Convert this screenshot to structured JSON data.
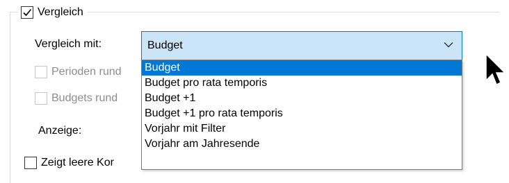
{
  "group": {
    "checkbox_label": "Vergleich",
    "checked": true
  },
  "compare": {
    "label": "Vergleich mit:",
    "selected": "Budget",
    "options": [
      "Budget",
      "Budget pro rata temporis",
      "Budget +1",
      "Budget +1 pro rata temporis",
      "Vorjahr mit Filter",
      "Vorjahr am Jahresende"
    ]
  },
  "options": {
    "periods_round_label": "Perioden rund",
    "budgets_round_label": "Budgets rund"
  },
  "display": {
    "label": "Anzeige:"
  },
  "show_empty": {
    "label": "Zeigt leere Kor",
    "checked": false
  },
  "colors": {
    "accent": "#0078d7",
    "combo_bg": "#cce4f7"
  },
  "icons": {
    "dropdown_arrow": "chevron-down-icon",
    "cursor": "mouse-pointer-icon"
  }
}
